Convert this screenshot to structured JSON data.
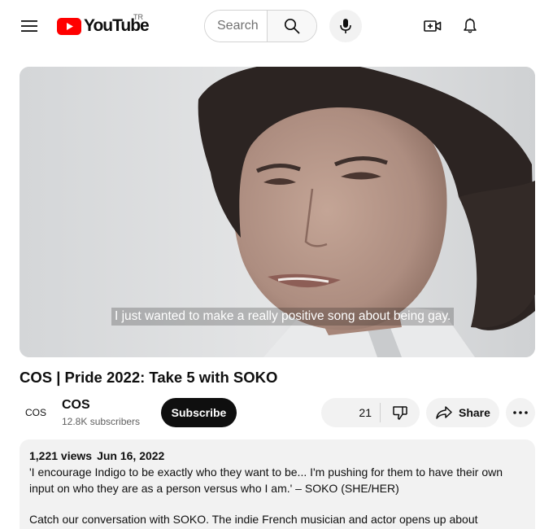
{
  "header": {
    "logo_text": "YouTube",
    "country_code": "TR",
    "search_placeholder": "Search"
  },
  "video": {
    "caption": "I just wanted to make a really positive song about being gay.",
    "title": "COS | Pride 2022: Take 5 with SOKO"
  },
  "channel": {
    "avatar_text": "COS",
    "name": "COS",
    "subscribers": "12.8K subscribers",
    "subscribe_label": "Subscribe"
  },
  "actions": {
    "like_count": "21",
    "share_label": "Share"
  },
  "description": {
    "views": "1,221 views",
    "date": "Jun 16, 2022",
    "line1": "'I encourage Indigo to be exactly who they want to be... I'm pushing for them to have their own input on who they are as a person versus who I am.' – SOKO (SHE/HER)",
    "line2": "Catch our conversation with SOKO. The indie French musician and actor opens up about"
  },
  "colors": {
    "brand_red": "#ff0000",
    "text": "#0f0f0f",
    "secondary_text": "#606060",
    "chip_bg": "#f2f2f2"
  }
}
